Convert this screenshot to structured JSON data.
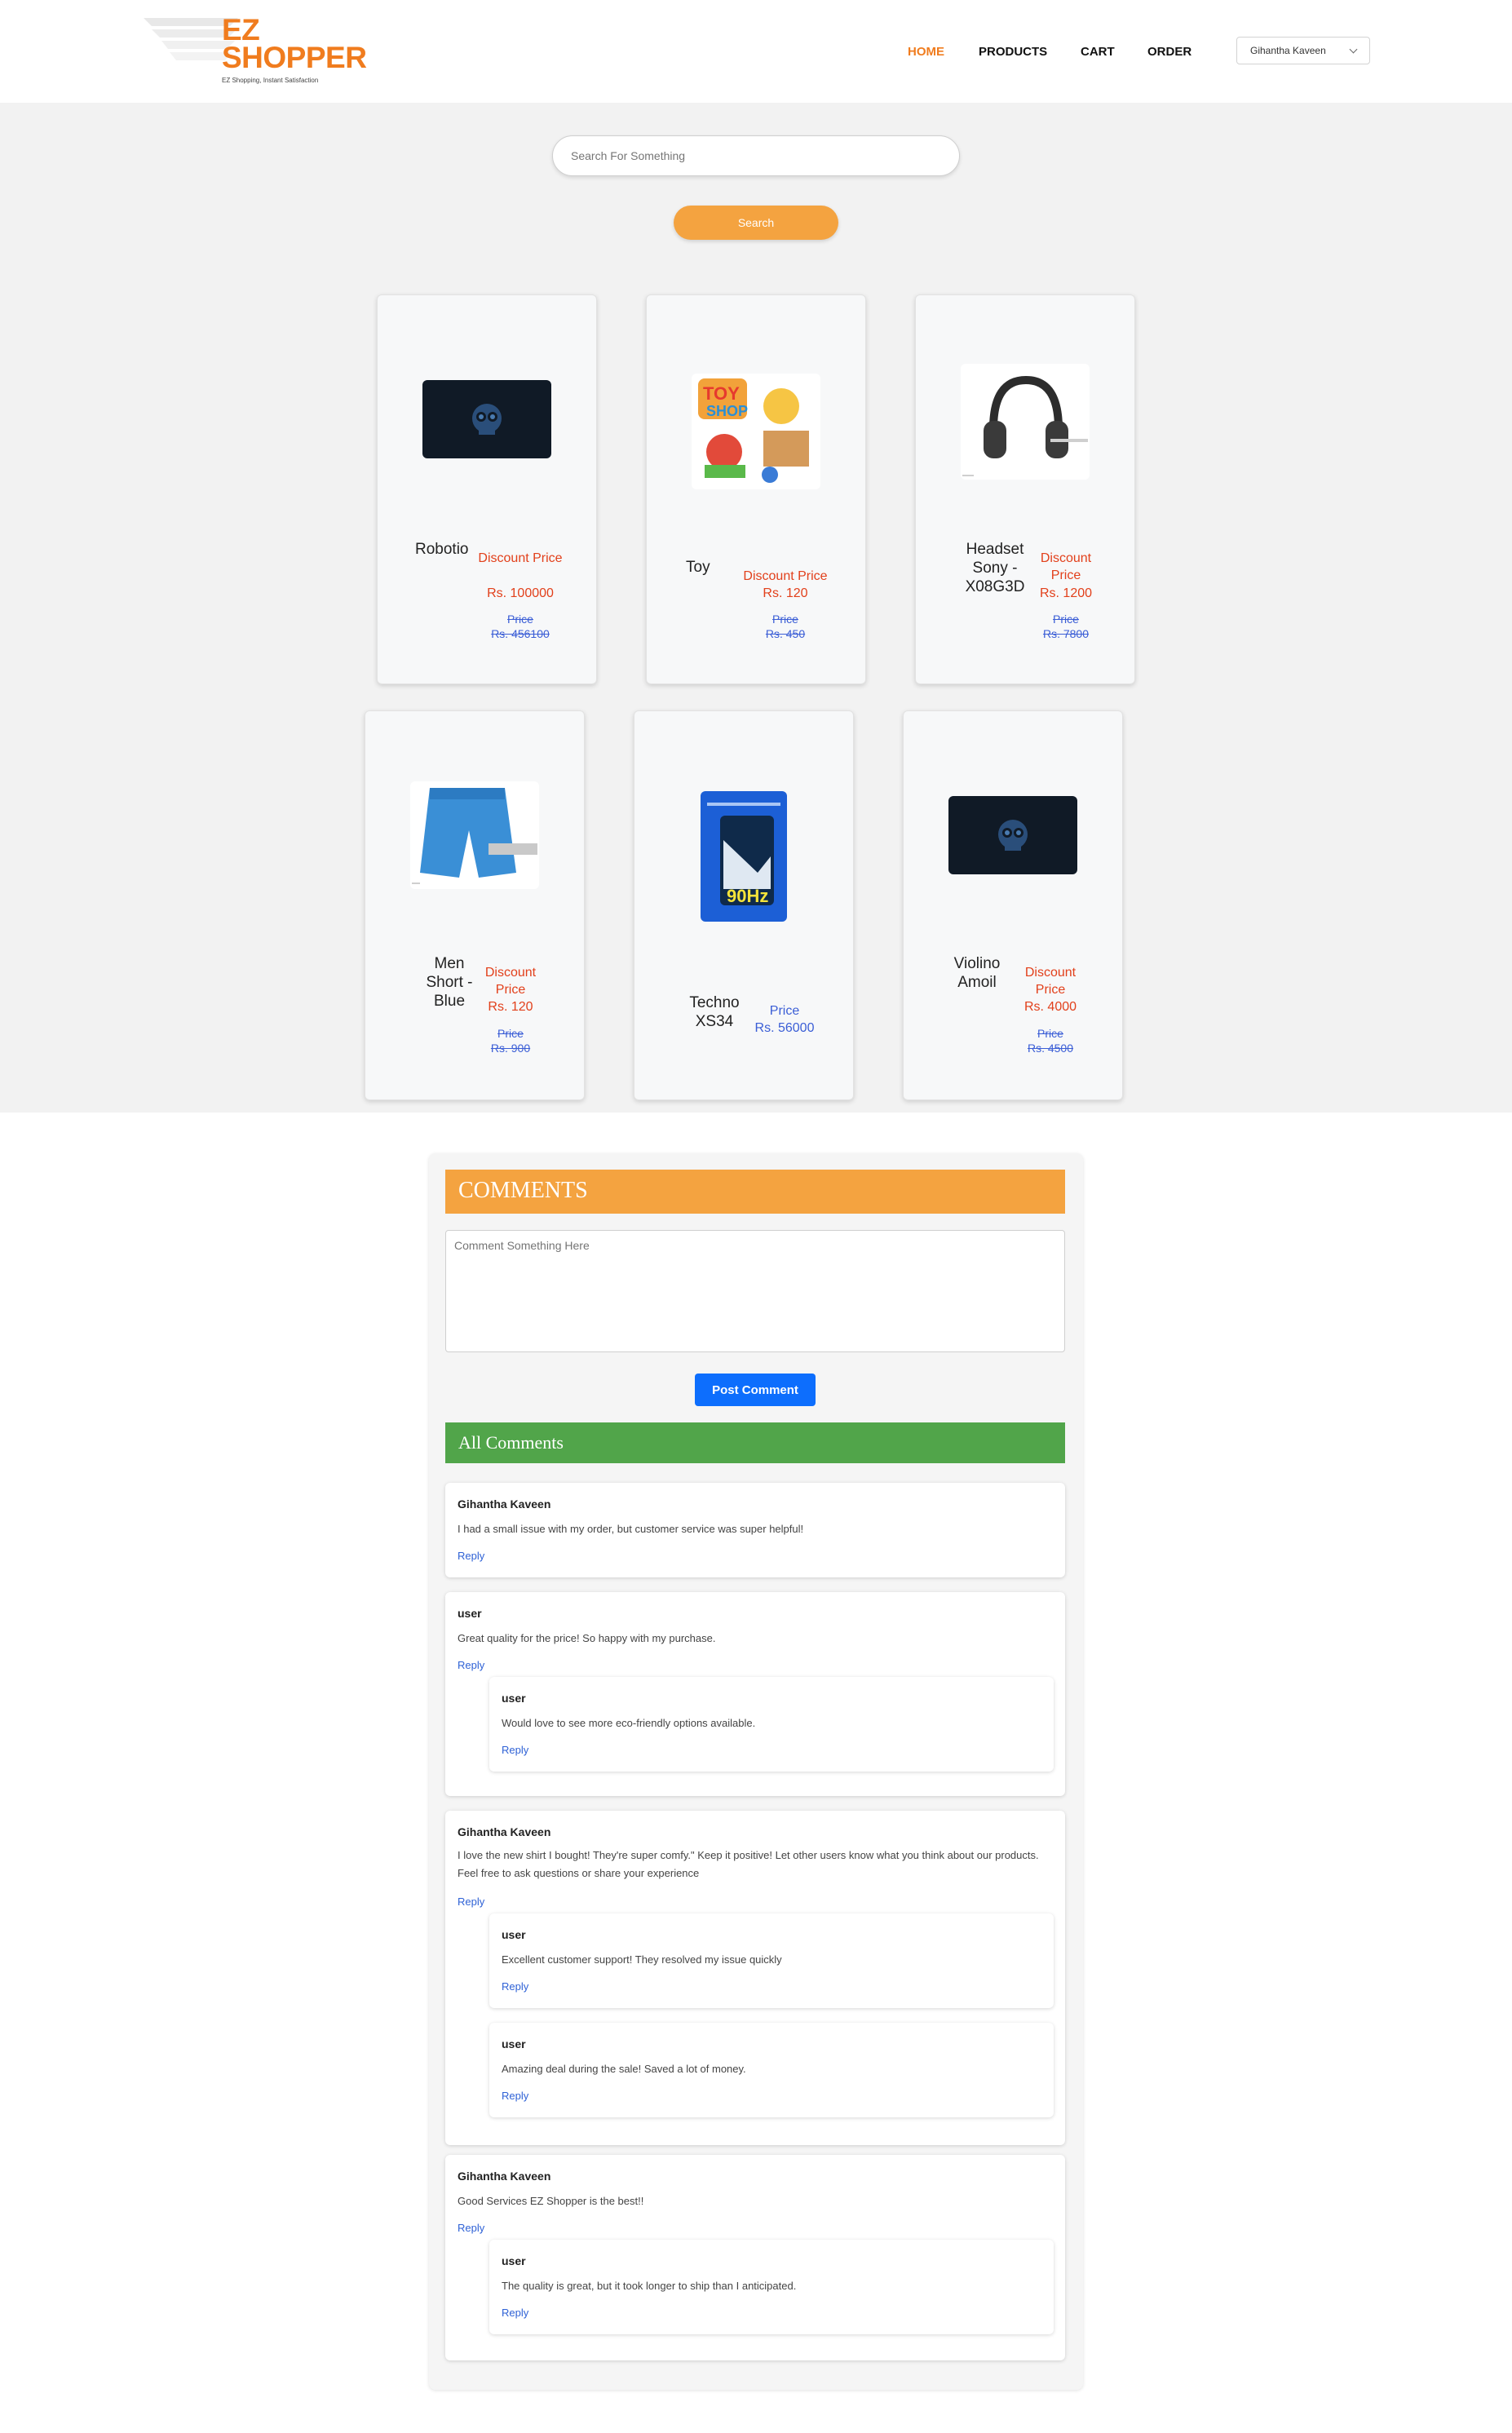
{
  "header": {
    "logo_line1": "EZ",
    "logo_line2": "SHOPPER",
    "tagline": "EZ Shopping, Instant Satisfaction",
    "nav": [
      {
        "label": "HOME",
        "active": true
      },
      {
        "label": "PRODUCTS",
        "active": false
      },
      {
        "label": "CART",
        "active": false
      },
      {
        "label": "ORDER",
        "active": false
      }
    ],
    "user_selected": "Gihantha Kaveen",
    "accent": "#f07c1e"
  },
  "search": {
    "placeholder": "Search For Something",
    "button_label": "Search"
  },
  "products": [
    {
      "name": "Robotio",
      "discount_label": "Discount Price",
      "discount_value": "Rs. 100000",
      "price_label": "Price",
      "price_value": "Rs. 456100",
      "image": "robot-logo"
    },
    {
      "name": "Toy",
      "discount_label": "Discount Price",
      "discount_value": "Rs. 120",
      "price_label": "Price",
      "price_value": "Rs. 450",
      "image": "toy-shop"
    },
    {
      "name": "Headset Sony - X08G3D",
      "discount_label": "Discount Price",
      "discount_value": "Rs. 1200",
      "price_label": "Price",
      "price_value": "Rs. 7800",
      "image": "headphones"
    },
    {
      "name": "Men Short - Blue",
      "discount_label": "Discount Price",
      "discount_value": "Rs. 120",
      "price_label": "Price",
      "price_value": "Rs. 900",
      "image": "blue-shorts"
    },
    {
      "name": "Techno XS34",
      "price_label": "Price",
      "price_value": "Rs. 56000",
      "image": "phone"
    },
    {
      "name": "Violino Amoil",
      "discount_label": "Discount Price",
      "discount_value": "Rs. 4000",
      "price_label": "Price",
      "price_value": "Rs. 4500",
      "image": "robot-logo"
    }
  ],
  "comments_section": {
    "title": "COMMENTS",
    "textarea_placeholder": "Comment Something Here",
    "post_label": "Post Comment",
    "all_title": "All Comments",
    "reply_label": "Reply",
    "comments": [
      {
        "author": "Gihantha Kaveen",
        "text": "I had a small issue with my order, but customer service was super helpful!",
        "replies": []
      },
      {
        "author": "user",
        "text": "Great quality for the price! So happy with my purchase.",
        "replies": [
          {
            "author": "user",
            "text": "Would love to see more eco-friendly options available."
          }
        ]
      },
      {
        "author": "Gihantha Kaveen",
        "text": "I love the new shirt I bought! They're super comfy.\" Keep it positive! Let other users know what you think about our products. Feel free to ask questions or share your experience",
        "replies": [
          {
            "author": "user",
            "text": "Excellent customer support! They resolved my issue quickly"
          },
          {
            "author": "user",
            "text": "Amazing deal during the sale! Saved a lot of money."
          }
        ]
      },
      {
        "author": "Gihantha Kaveen",
        "text": "Good Services EZ Shopper is the best!!",
        "replies": [
          {
            "author": "user",
            "text": "The quality is great, but it took longer to ship than I anticipated."
          }
        ]
      }
    ]
  },
  "colors": {
    "discount": "#e2401b",
    "price": "#3b5ed6",
    "comments_header": "#f4a340",
    "all_comments_header": "#51a54a",
    "post_button": "#0d6efd"
  }
}
